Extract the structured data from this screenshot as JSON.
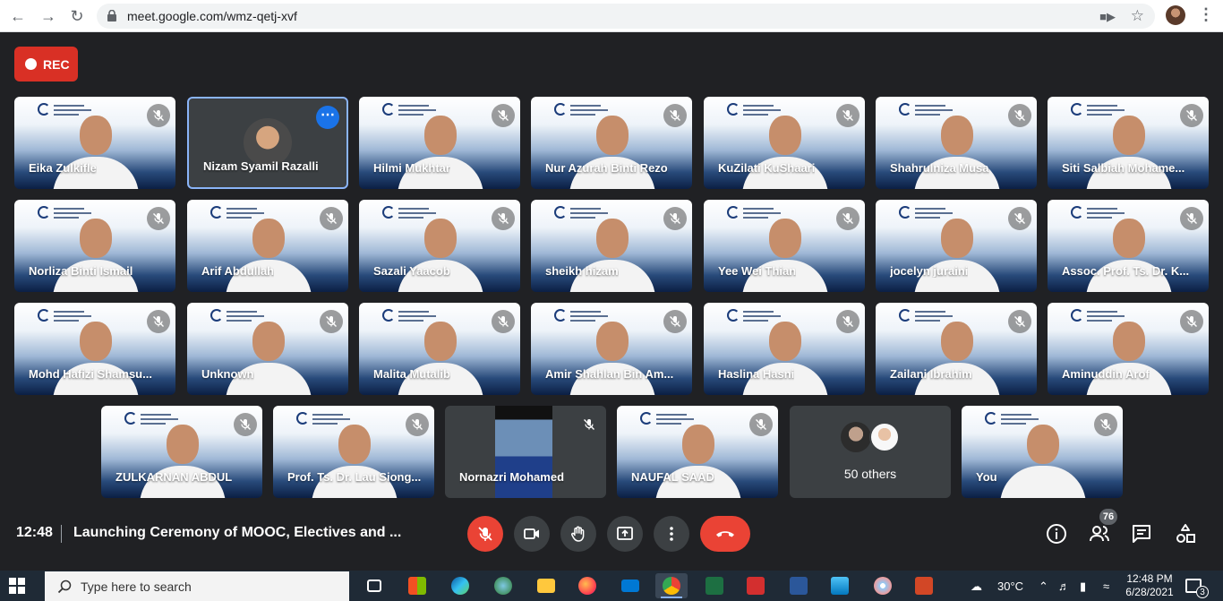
{
  "browser": {
    "url": "meet.google.com/wmz-qetj-xvf"
  },
  "rec": {
    "label": "REC"
  },
  "tiles": [
    {
      "name": "Eika Zulkifle"
    },
    {
      "name": "Nizam Syamil Razalli"
    },
    {
      "name": "Hilmi Mukhtar"
    },
    {
      "name": "Nur Azurah Binti Rezo"
    },
    {
      "name": "KuZilati KuShaari"
    },
    {
      "name": "Shahrulniza Musa"
    },
    {
      "name": "Siti Salbiah Mohame..."
    },
    {
      "name": "Norliza Binti Ismail"
    },
    {
      "name": "Arif Abdullah"
    },
    {
      "name": "Sazali Yaacob"
    },
    {
      "name": "sheikh hizam"
    },
    {
      "name": "Yee Wei Thian"
    },
    {
      "name": "jocelyn juraini"
    },
    {
      "name": "Assoc. Prof. Ts. Dr. K..."
    },
    {
      "name": "Mohd Hafizi Shamsu..."
    },
    {
      "name": "Unknown"
    },
    {
      "name": "Malita Mutalib"
    },
    {
      "name": "Amir Shahlan Bin Am..."
    },
    {
      "name": "Haslina Hasni"
    },
    {
      "name": "Zailani Ibrahim"
    },
    {
      "name": "Aminuddin Arof"
    },
    {
      "name": "ZULKARNAN ABDUL"
    },
    {
      "name": "Prof. Ts. Dr. Lau Siong..."
    },
    {
      "name": "Nornazri Mohamed"
    },
    {
      "name": "NAUFAL SAAD"
    },
    {
      "name": "You"
    }
  ],
  "others": {
    "label": "50 others"
  },
  "bottom": {
    "time": "12:48",
    "title": "Launching Ceremony of MOOC, Electives and ...",
    "participants_count": "76"
  },
  "taskbar": {
    "search_placeholder": "Type here to search",
    "temperature": "30°C",
    "time": "12:48 PM",
    "date": "6/28/2021",
    "notifications": "3"
  }
}
